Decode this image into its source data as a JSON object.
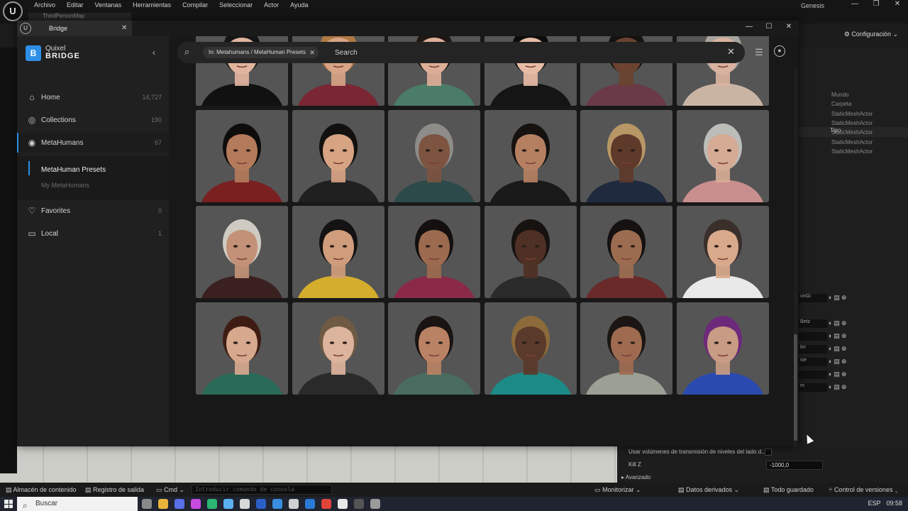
{
  "editor": {
    "logo": "U",
    "menu": [
      "Archivo",
      "Editar",
      "Ventanas",
      "Herramientas",
      "Compilar",
      "Seleccionar",
      "Actor",
      "Ayuda"
    ],
    "level_tab": "ThirdPersonMap",
    "project_name": "Genesis",
    "window_controls": [
      "—",
      "❐",
      "✕"
    ],
    "config_label": "⚙ Configuración ⌄",
    "outliner": {
      "header": "Tipo",
      "types": [
        "Mundo",
        "Carpeta",
        "StaticMeshActor",
        "StaticMeshActor",
        "StaticMeshActor",
        "StaticMeshActor",
        "StaticMeshActor"
      ]
    },
    "details_controls": [
      "onGi",
      "Betz",
      "",
      "ler",
      "ise",
      "",
      "m"
    ],
    "settings": {
      "stream_label": "Usar volúmenes de transmisión de niveles del lado d...",
      "killz_label": "Kill Z",
      "killz_value": "-1000,0",
      "advanced_label": "▸  Avanzado"
    },
    "statusbar": {
      "content": "▤ Almacén de contenido",
      "output": "▤ Registro de salida",
      "cmd": "▭ Cmd ⌄",
      "cmd_placeholder": "Introducir comando de consola",
      "monitor": "▭ Monitorizar ⌄",
      "derived": "▤ Datos derivados ⌄",
      "saved": "▤ Todo guardado",
      "vcs": "⑂ Control de versiones ⌄"
    }
  },
  "taskbar": {
    "search_placeholder": "Buscar",
    "app_colors": [
      "#8a8a8a",
      "#e8b33a",
      "#5a6ee8",
      "#c84be0",
      "#2bb673",
      "#5ab0f0",
      "#d8d8d8",
      "#2b5fc8",
      "#3a8de0",
      "#d0d0d0",
      "#2a7ad8",
      "#e0443a",
      "#e8e8e8",
      "#555555",
      "#9a9a9a"
    ],
    "tray": {
      "lang": "ESP",
      "time": "09:58"
    }
  },
  "bridge": {
    "window_title": "Bridge",
    "tab_close": "✕",
    "window_controls": [
      "—",
      "☐",
      "✕"
    ],
    "logo": {
      "letter": "B",
      "brand_small": "Quixel",
      "brand_big": "BRIDGE",
      "collapse": "‹"
    },
    "nav": [
      {
        "label": "Home",
        "count": "14,727",
        "icon": "⌂"
      },
      {
        "label": "Collections",
        "count": "190",
        "icon": "◎"
      },
      {
        "label": "MetaHumans",
        "count": "67",
        "icon": "◉"
      },
      {
        "label": "Favorites",
        "count": "0",
        "icon": "♡"
      },
      {
        "label": "Local",
        "count": "1",
        "icon": "▭"
      }
    ],
    "subnav": [
      "MetaHuman Presets",
      "My MetaHumans"
    ],
    "search": {
      "filter_chip": "In: Metahumans / MetaHuman Presets",
      "chip_close": "✕",
      "placeholder": "Search",
      "clear": "✕"
    },
    "presets": [
      {
        "skin": "#e0b49e",
        "hair": "#141414",
        "shirt": "#111111"
      },
      {
        "skin": "#d7a486",
        "hair": "#b07843",
        "shirt": "#7a2733"
      },
      {
        "skin": "#dcae98",
        "hair": "#1f1714",
        "shirt": "#4a7c67"
      },
      {
        "skin": "#e6bba5",
        "hair": "#0c0c0c",
        "shirt": "#151515"
      },
      {
        "skin": "#6b4331",
        "hair": "#161210",
        "shirt": "#6a3a48"
      },
      {
        "skin": "#d9b3a0",
        "hair": "#a8a39d",
        "shirt": "#c9b4a4"
      },
      {
        "skin": "#b47a5c",
        "hair": "#0f0d0c",
        "shirt": "#7a2020"
      },
      {
        "skin": "#d6a383",
        "hair": "#121110",
        "shirt": "#202020"
      },
      {
        "skin": "#7c5440",
        "hair": "#8e8c89",
        "shirt": "#2d4a4a"
      },
      {
        "skin": "#b58062",
        "hair": "#151210",
        "shirt": "#1a1a1a"
      },
      {
        "skin": "#5e3a2a",
        "hair": "#b89766",
        "shirt": "#1f2a3f"
      },
      {
        "skin": "#d5ab95",
        "hair": "#bcbcb9",
        "shirt": "#c98f8f"
      },
      {
        "skin": "#c29177",
        "hair": "#cfcbc3",
        "shirt": "#3a2120"
      },
      {
        "skin": "#cf9d7c",
        "hair": "#141212",
        "shirt": "#d4ad2c"
      },
      {
        "skin": "#9b6a4f",
        "hair": "#141010",
        "shirt": "#8a2a48"
      },
      {
        "skin": "#4f3024",
        "hair": "#161210",
        "shirt": "#2a2a2a"
      },
      {
        "skin": "#9c6c51",
        "hair": "#151111",
        "shirt": "#6a2a2a"
      },
      {
        "skin": "#d9a98c",
        "hair": "#3a2f2a",
        "shirt": "#e9e9e9"
      },
      {
        "skin": "#d6a88e",
        "hair": "#3f1c13",
        "shirt": "#2a6a58"
      },
      {
        "skin": "#dcb39c",
        "hair": "#6e5a45",
        "shirt": "#2a2a2a"
      },
      {
        "skin": "#b98264",
        "hair": "#1a1412",
        "shirt": "#4a6c60"
      },
      {
        "skin": "#5a3a2a",
        "hair": "#8c6a3a",
        "shirt": "#1c8a86"
      },
      {
        "skin": "#9e6a50",
        "hair": "#1b1613",
        "shirt": "#9aa094"
      },
      {
        "skin": "#c89c84",
        "hair": "#6e2a7a",
        "shirt": "#2a4ab0"
      }
    ]
  }
}
